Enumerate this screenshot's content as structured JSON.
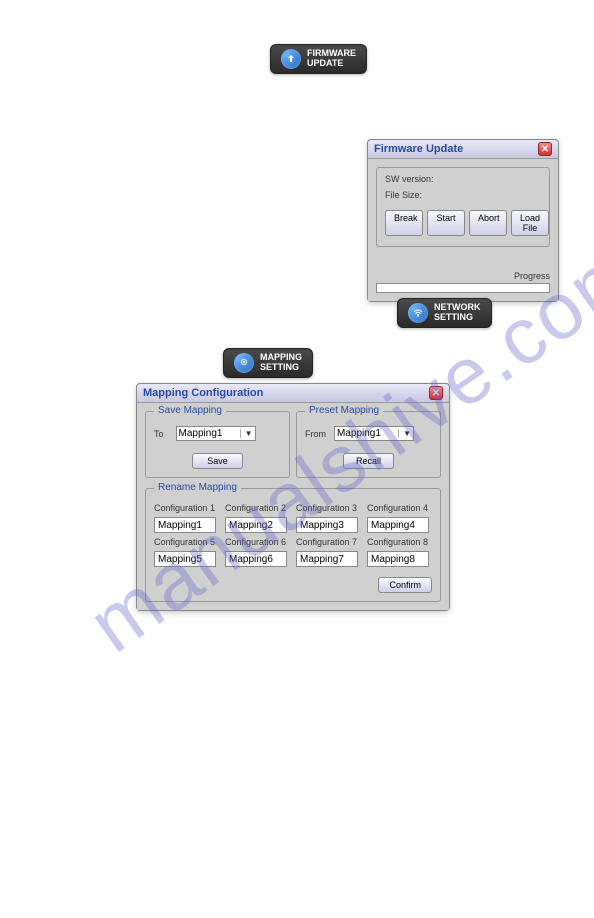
{
  "buttons": {
    "firmware_update": "FIRMWARE\nUPDATE",
    "network_setting": "NETWORK\nSETTING",
    "mapping_setting": "MAPPING\nSETTING"
  },
  "firmware_window": {
    "title": "Firmware Update",
    "sw_version_label": "SW version:",
    "file_size_label": "File Size:",
    "btn_break": "Break",
    "btn_start": "Start",
    "btn_abort": "Abort",
    "btn_load_file": "Load File",
    "progress_label": "Progress"
  },
  "mapping_window": {
    "title": "Mapping Configuration",
    "save_group": "Save Mapping",
    "preset_group": "Preset Mapping",
    "rename_group": "Rename Mapping",
    "to_label": "To",
    "from_label": "From",
    "save_btn": "Save",
    "recall_btn": "Recall",
    "confirm_btn": "Confirm",
    "select_to": "Mapping1",
    "select_from": "Mapping1",
    "config_labels": [
      "Configuration 1",
      "Configuration 2",
      "Configuration 3",
      "Configuration 4",
      "Configuration 5",
      "Configuration 6",
      "Configuration 7",
      "Configuration 8"
    ],
    "config_values": [
      "Mapping1",
      "Mapping2",
      "Mapping3",
      "Mapping4",
      "Mapping5",
      "Mapping6",
      "Mapping7",
      "Mapping8"
    ]
  },
  "watermark": "manualshive.com"
}
